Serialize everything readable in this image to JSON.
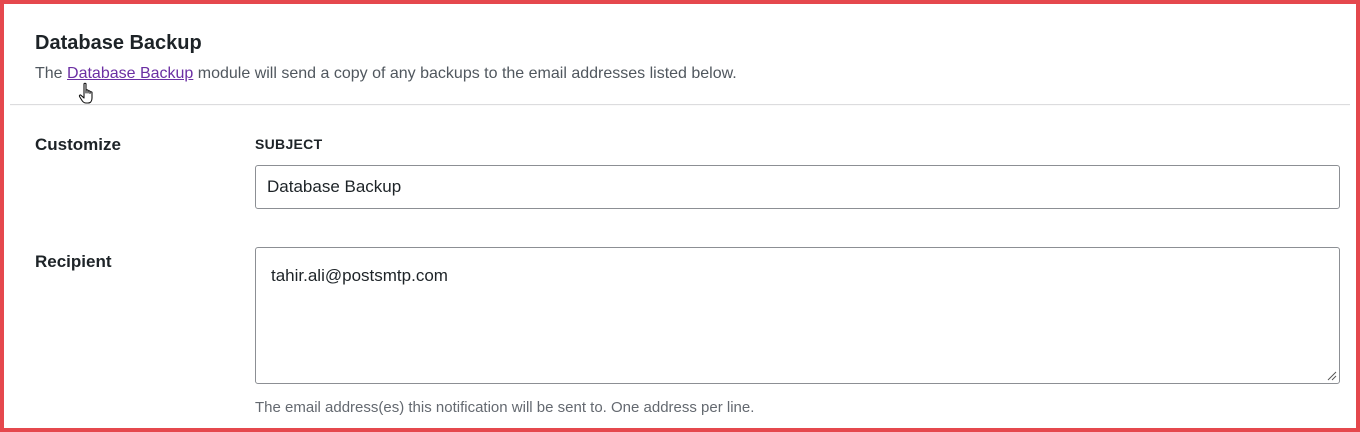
{
  "header": {
    "title": "Database Backup",
    "desc_prefix": "The ",
    "desc_link": "Database Backup",
    "desc_suffix": " module will send a copy of any backups to the email addresses listed below."
  },
  "customize": {
    "label": "Customize",
    "subject_label": "SUBJECT",
    "subject_value": "Database Backup"
  },
  "recipient": {
    "label": "Recipient",
    "value": "tahir.ali@postsmtp.com",
    "help": "The email address(es) this notification will be sent to. One address per line."
  },
  "colors": {
    "frame_border": "#e5484d",
    "link": "#6b2fa3",
    "input_border": "#8c8f94"
  },
  "icons": {
    "cursor": "hand-pointer-icon",
    "resize": "resize-grip-icon"
  }
}
